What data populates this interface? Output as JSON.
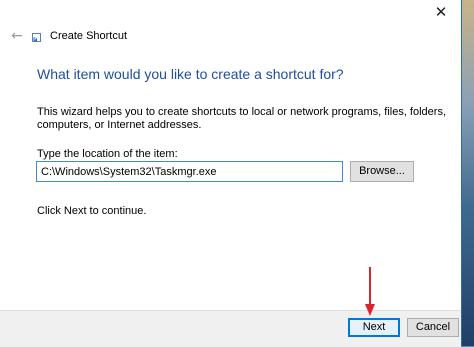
{
  "window": {
    "title": "Create Shortcut",
    "close_glyph": "✕",
    "back_glyph": "←",
    "app_icon": "shortcut-icon"
  },
  "content": {
    "heading": "What item would you like to create a shortcut for?",
    "description": "This wizard helps you to create shortcuts to local or network programs, files, folders, computers, or Internet addresses.",
    "location_label": "Type the location of the item:",
    "location_value": "C:\\Windows\\System32\\Taskmgr.exe",
    "browse_label": "Browse...",
    "hint": "Click Next to continue."
  },
  "footer": {
    "next_label": "Next",
    "cancel_label": "Cancel"
  },
  "colors": {
    "heading": "#1f4e9c",
    "accent": "#0078d7",
    "annotation_arrow": "#d9252b"
  }
}
